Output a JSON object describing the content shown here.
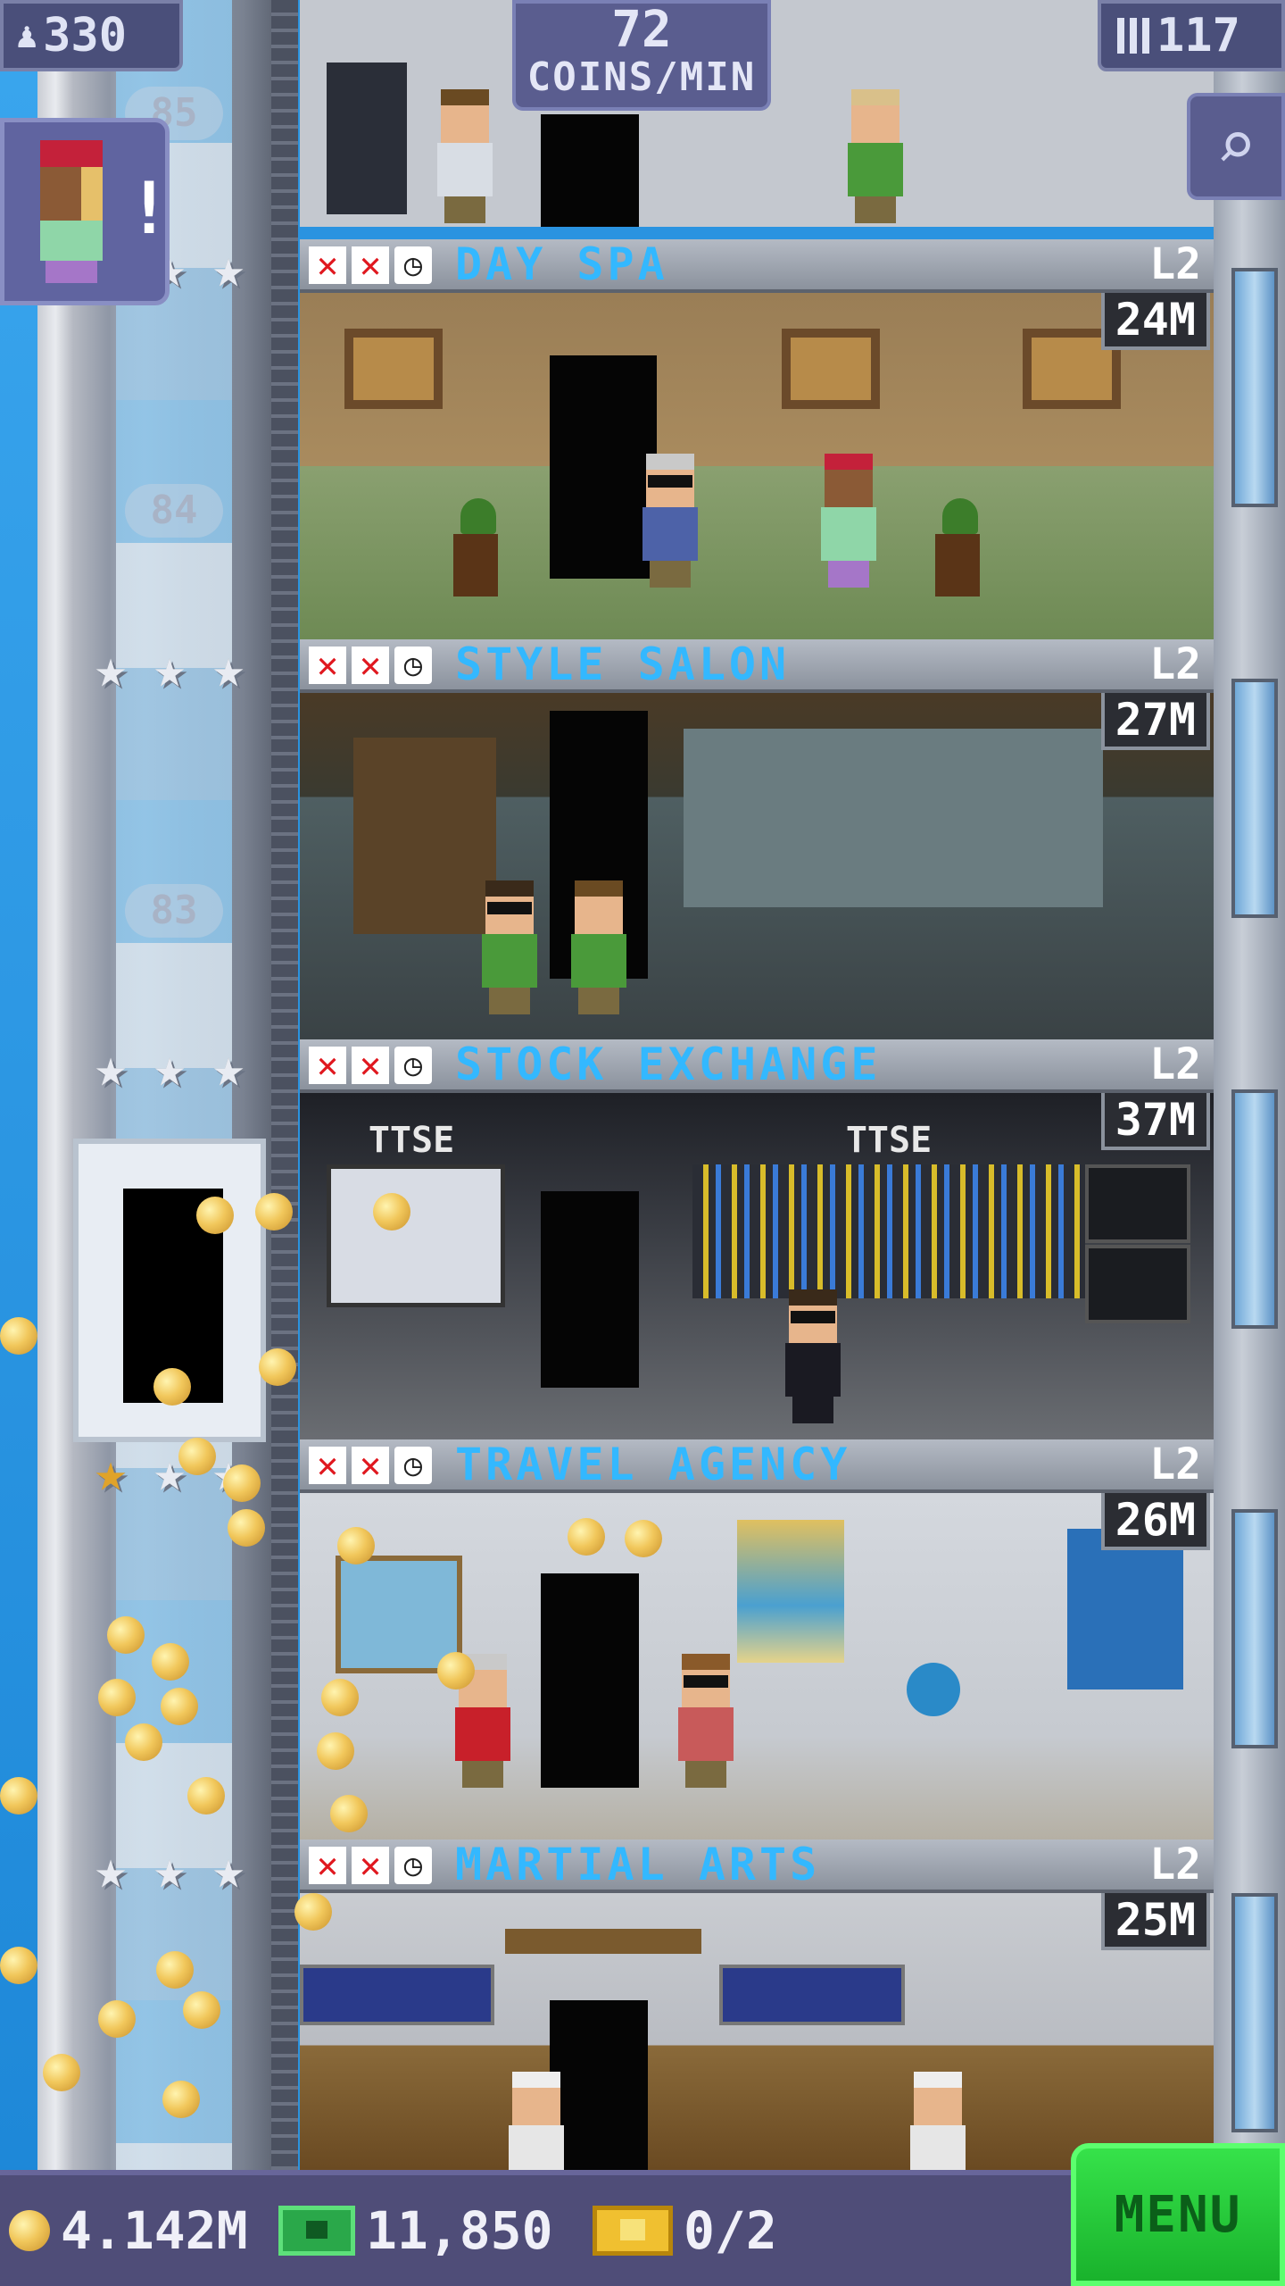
{
  "hud": {
    "population": "330",
    "coins_rate_value": "72",
    "coins_rate_label": "COINS/MIN",
    "floors": "117",
    "population_icon": "person-icon",
    "floors_icon": "building-icon",
    "search_icon": "magnifier-icon"
  },
  "visitor": {
    "alert": "!"
  },
  "shaft_floor_numbers": [
    "85",
    "84",
    "83"
  ],
  "floors": [
    {
      "name": "DAY SPA",
      "level": "L2",
      "stock": "24M"
    },
    {
      "name": "STYLE SALON",
      "level": "L2",
      "stock": "27M"
    },
    {
      "name": "STOCK EXCHANGE",
      "level": "L2",
      "stock": "37M"
    },
    {
      "name": "TRAVEL AGENCY",
      "level": "L2",
      "stock": "26M"
    },
    {
      "name": "MARTIAL ARTS",
      "level": "L2",
      "stock": "25M"
    }
  ],
  "room_signs": {
    "stock_left": "TTSE",
    "stock_right": "TTSE"
  },
  "bottom": {
    "coins": "4.142M",
    "bux": "11,850",
    "tickets": "0/2",
    "menu": "MENU"
  },
  "colors": {
    "floor_name": "#33b8ff",
    "menu_button": "#2ad63e",
    "hud_panel": "#4a4f7a"
  }
}
